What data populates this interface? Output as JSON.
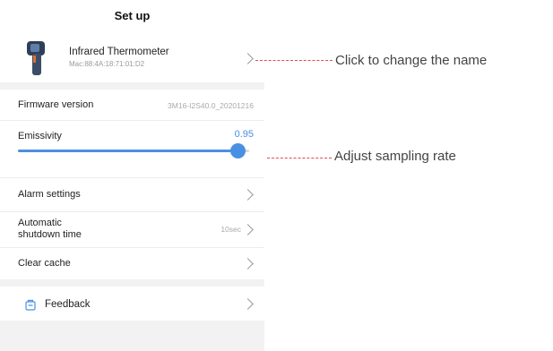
{
  "header": {
    "title": "Set up"
  },
  "device": {
    "name": "Infrared Thermometer",
    "mac": "Mac:88:4A:18:71:01:D2"
  },
  "settings": {
    "firmware_label": "Firmware version",
    "firmware_value": "3M16-I2S40.0_20201216",
    "emissivity_label": "Emissivity",
    "emissivity_value": "0.95",
    "emissivity_level": 0.95,
    "alarm_label": "Alarm settings",
    "shutdown_label": "Automatic\nshutdown time",
    "shutdown_value": "10sec",
    "clear_cache_label": "Clear cache"
  },
  "feedback": {
    "label": "Feedback"
  },
  "annotations": {
    "rename": "Click to change the name",
    "sampling": "Adjust sampling rate"
  },
  "colors": {
    "accent": "#4a90e2",
    "annotation_line": "#e24b4b",
    "section_gap": "#f2f2f2"
  },
  "icons": [
    "thermometer-gun-icon",
    "chevron-right-icon",
    "feedback-icon"
  ]
}
